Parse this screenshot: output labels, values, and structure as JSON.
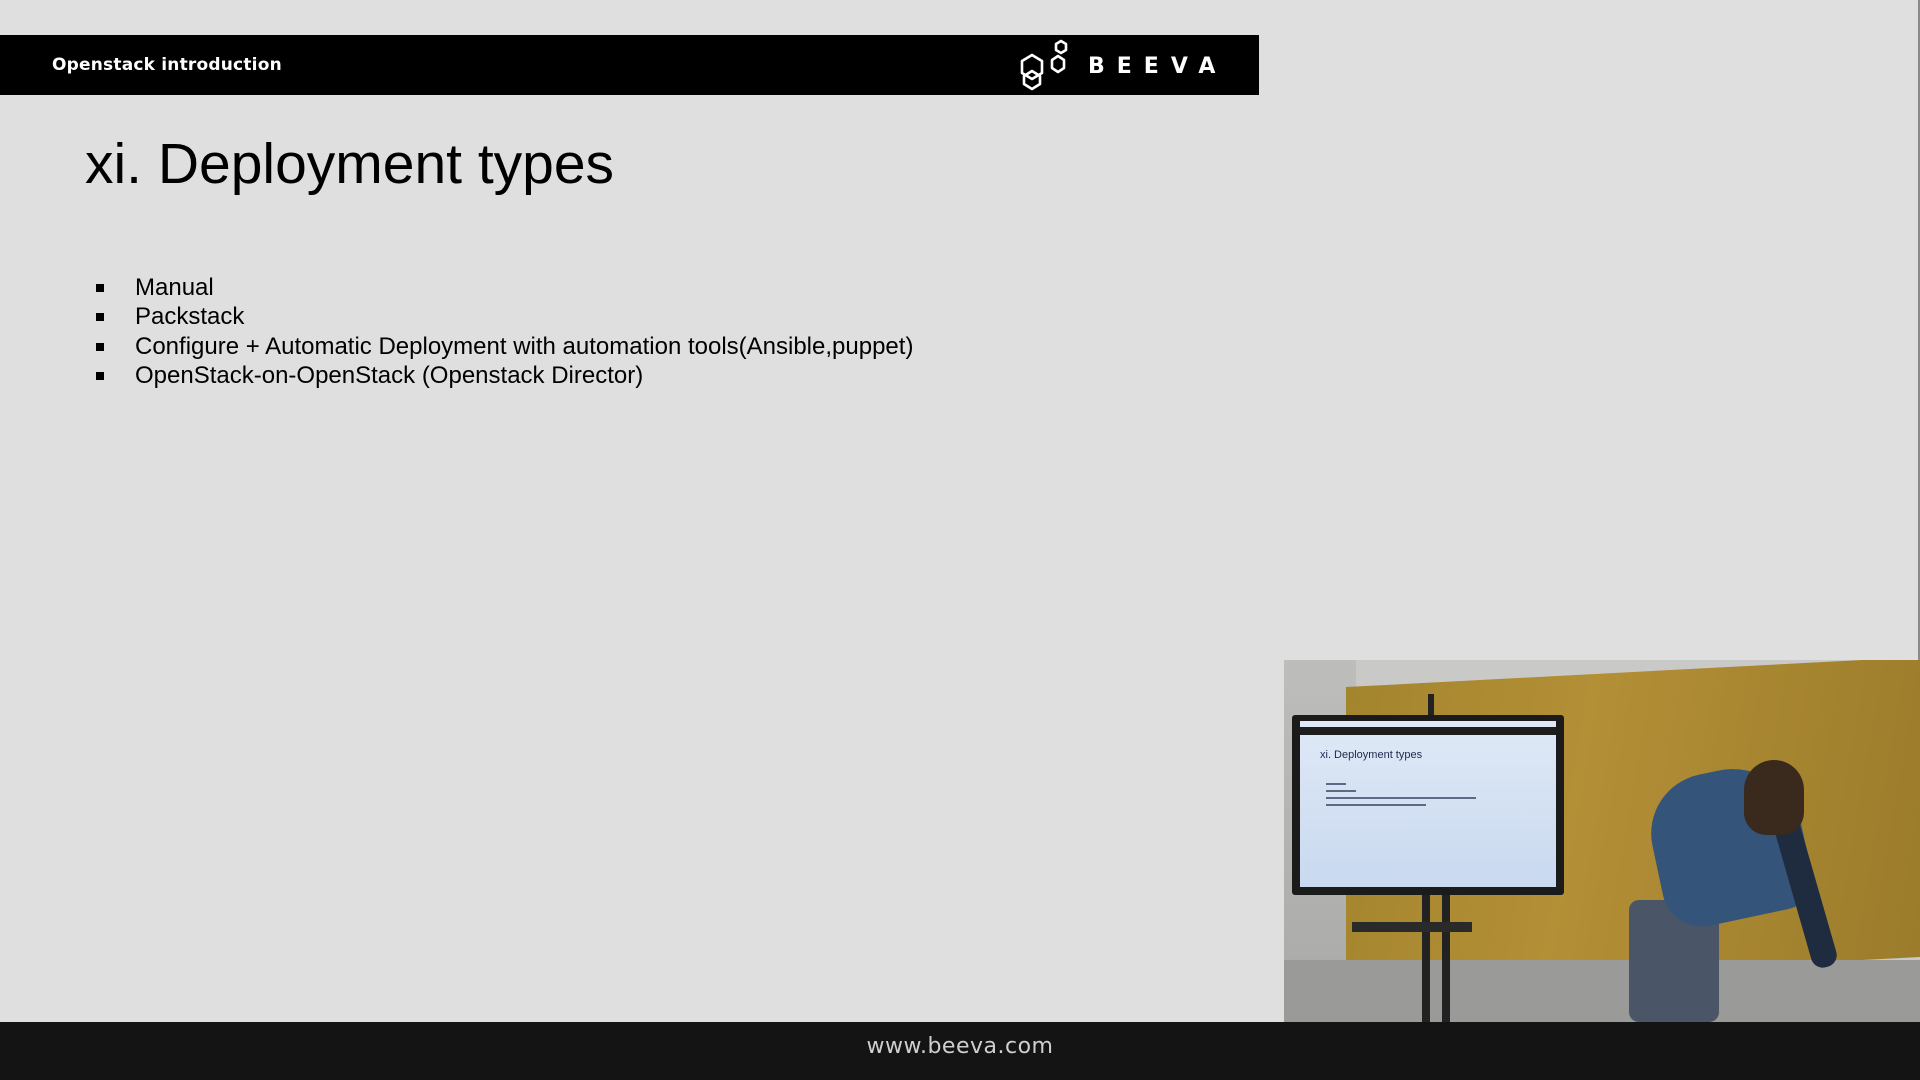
{
  "slide": {
    "header_title": "Openstack introduction",
    "logo_text": "BEEVA",
    "title": "xi. Deployment types",
    "bullets": [
      "Manual",
      "Packstack",
      "Configure + Automatic Deployment with automation tools(Ansible,puppet)",
      "OpenStack-on-OpenStack (Openstack Director)"
    ]
  },
  "webcam": {
    "tv_title": "xi. Deployment types"
  },
  "footer": {
    "url": "www.beeva.com"
  },
  "colors": {
    "slide_background": "#dfdfdf",
    "header_bar": "#000000",
    "footer_bar": "#141414"
  },
  "icons": {
    "logo": "beeva-hexagon-logo-icon",
    "bullet": "square-bullet-icon"
  }
}
